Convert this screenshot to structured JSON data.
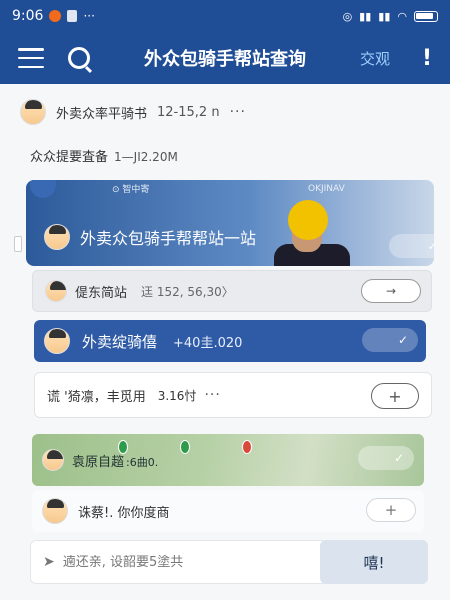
{
  "status_bar": {
    "time": "9:06",
    "icons": [
      "alarm-icon",
      "signal-icon",
      "signal-icon",
      "wifi-icon",
      "battery-icon"
    ]
  },
  "header": {
    "title": "外众包骑手帮站查询",
    "right_link": "交观",
    "right_icon": "!"
  },
  "user": {
    "name": "外卖众率平骑书",
    "meta": "12-15,2 n",
    "more": "···"
  },
  "subheading": {
    "text": "众众提要査备",
    "meta": "1—JI2.20M"
  },
  "banner": {
    "tag_left": "⊙ 智中寄",
    "tag_right": "OKJINAV",
    "title": "外卖众包骑手帮帮站一站"
  },
  "rows": {
    "grey": {
      "label": "偍东简站",
      "meta": "迋 152, 56,30〉",
      "button_icon": "→"
    },
    "blue": {
      "label": "外卖绽骑僖",
      "meta": "+40圭.020",
      "button_icon": "✓"
    },
    "white": {
      "label": "谎 '猗凛，丰觅用",
      "meta": "3.16忖",
      "more": "···",
      "button_icon": "+"
    },
    "map": {
      "label": "袁原自趦",
      "meta": ":6曲0.",
      "button_icon": "✓"
    },
    "white2": {
      "label": "诛蔡!. 你你度商",
      "button_icon": "+"
    }
  },
  "input": {
    "placeholder": "遖还亲, 设韶要5塗共",
    "send_label": "嘻!"
  },
  "colors": {
    "header_bg": "#1f4d96",
    "accent_blue": "#2e5aa6",
    "link": "#9fd0ff",
    "map_green": "#9dc08a"
  }
}
